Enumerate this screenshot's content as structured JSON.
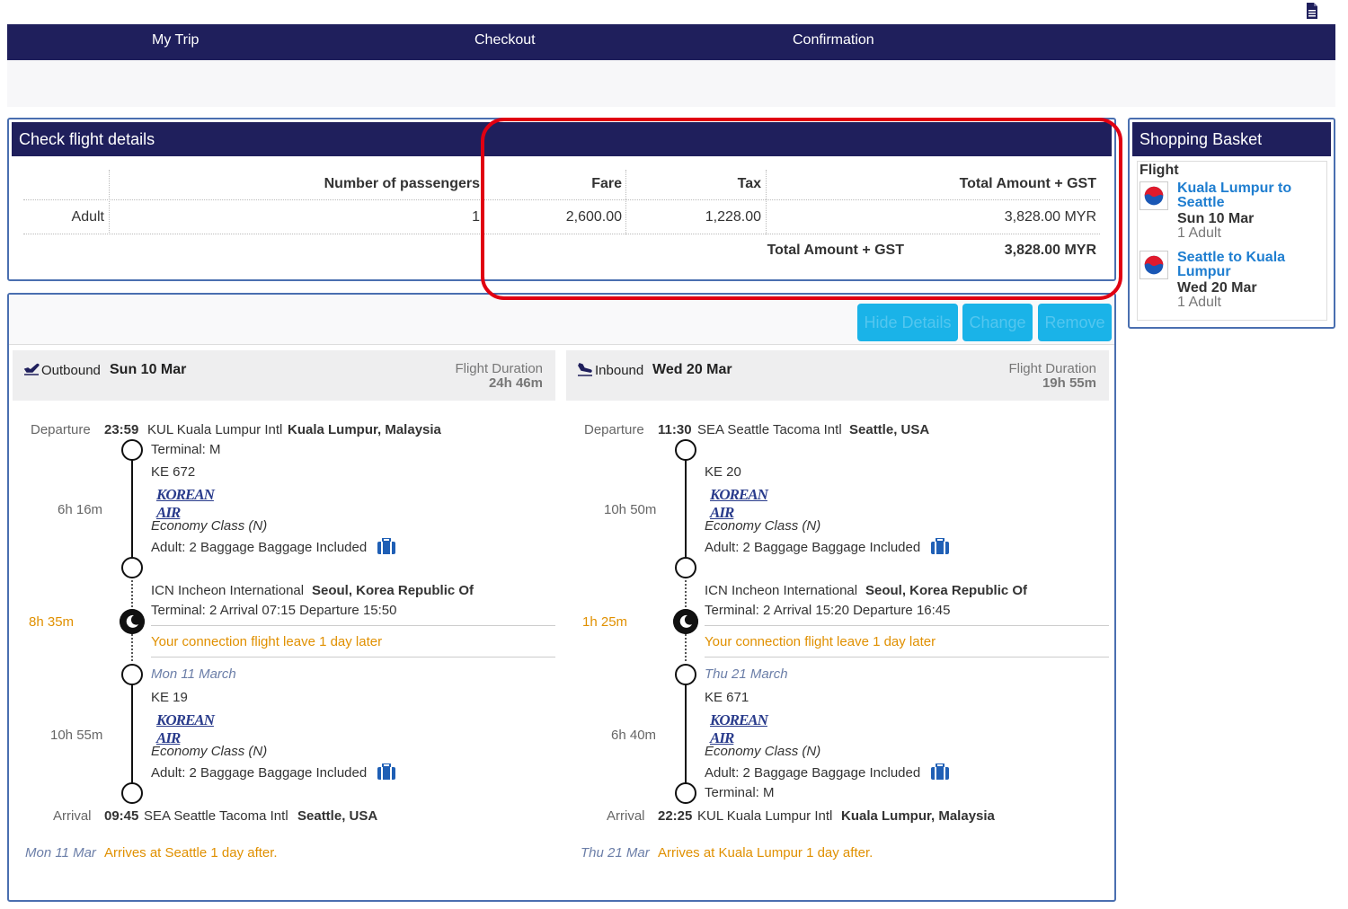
{
  "nav": {
    "tabs": [
      "My Trip",
      "Checkout",
      "Confirmation"
    ]
  },
  "details": {
    "title": "Check flight details",
    "headers": {
      "passengers": "Number of passengers",
      "fare": "Fare",
      "tax": "Tax",
      "total": "Total Amount + GST"
    },
    "row": {
      "type": "Adult",
      "count": "1",
      "fare": "2,600.00",
      "tax": "1,228.00",
      "total": "3,828.00 MYR"
    },
    "grand_label": "Total Amount + GST",
    "grand_value": "3,828.00 MYR"
  },
  "basket": {
    "title": "Shopping Basket",
    "section": "Flight",
    "items": [
      {
        "route": "Kuala Lumpur to Seattle",
        "date": "Sun 10 Mar",
        "pax": "1 Adult"
      },
      {
        "route": "Seattle to Kuala Lumpur",
        "date": "Wed 20 Mar",
        "pax": "1 Adult"
      }
    ]
  },
  "buttons": {
    "hide": "Hide Details",
    "change": "Change",
    "remove": "Remove"
  },
  "colors": {
    "navy": "#1f1f5c",
    "accent_button": "#1ab3e8",
    "highlight": "#e00012",
    "warning": "#e09000",
    "link": "#1f7ed0"
  },
  "legs": [
    {
      "direction": "Outbound",
      "date": "Sun 10 Mar",
      "duration_label": "Flight Duration",
      "duration": "24h 46m",
      "departure_label": "Departure",
      "dep_time": "23:59",
      "dep_airport": "KUL Kuala Lumpur Intl",
      "dep_city": "Kuala Lumpur, Malaysia",
      "seg1_terminal": "Terminal: M",
      "seg1_flight": "KE 672",
      "seg1_duration": "6h 16m",
      "airline_logo": "KOREAN AIR",
      "seg1_class": "Economy Class (N)",
      "seg1_baggage": "Adult: 2 Baggage Baggage Included",
      "conn_airport": "ICN Incheon International",
      "conn_city": "Seoul, Korea Republic Of",
      "conn_details": "Terminal: 2  Arrival 07:15 Departure 15:50",
      "layover": "8h 35m",
      "conn_note": "Your connection flight leave 1 day later",
      "seg2_date": "Mon 11 March",
      "seg2_flight": "KE 19",
      "seg2_duration": "10h 55m",
      "seg2_class": "Economy Class (N)",
      "seg2_baggage": "Adult: 2 Baggage Baggage Included",
      "seg2_terminal": "",
      "arrival_label": "Arrival",
      "arr_time": "09:45",
      "arr_airport": "SEA Seattle Tacoma Intl",
      "arr_city": "Seattle, USA",
      "arr_date": "Mon 11 Mar",
      "arr_note": "Arrives at Seattle 1 day after."
    },
    {
      "direction": "Inbound",
      "date": "Wed 20 Mar",
      "duration_label": "Flight Duration",
      "duration": "19h 55m",
      "departure_label": "Departure",
      "dep_time": "11:30",
      "dep_airport": "SEA Seattle Tacoma Intl",
      "dep_city": "Seattle, USA",
      "seg1_terminal": "",
      "seg1_flight": "KE 20",
      "seg1_duration": "10h 50m",
      "airline_logo": "KOREAN AIR",
      "seg1_class": "Economy Class (N)",
      "seg1_baggage": "Adult: 2 Baggage Baggage Included",
      "conn_airport": "ICN Incheon International",
      "conn_city": "Seoul, Korea Republic Of",
      "conn_details": "Terminal: 2  Arrival 15:20 Departure 16:45",
      "layover": "1h 25m",
      "conn_note": "Your connection flight leave 1 day later",
      "seg2_date": "Thu 21 March",
      "seg2_flight": "KE 671",
      "seg2_duration": "6h 40m",
      "seg2_class": "Economy Class (N)",
      "seg2_baggage": "Adult: 2 Baggage Baggage Included",
      "seg2_terminal": "Terminal: M",
      "arrival_label": "Arrival",
      "arr_time": "22:25",
      "arr_airport": "KUL Kuala Lumpur Intl",
      "arr_city": "Kuala Lumpur, Malaysia",
      "arr_date": "Thu 21 Mar",
      "arr_note": "Arrives at Kuala Lumpur 1 day after."
    }
  ]
}
